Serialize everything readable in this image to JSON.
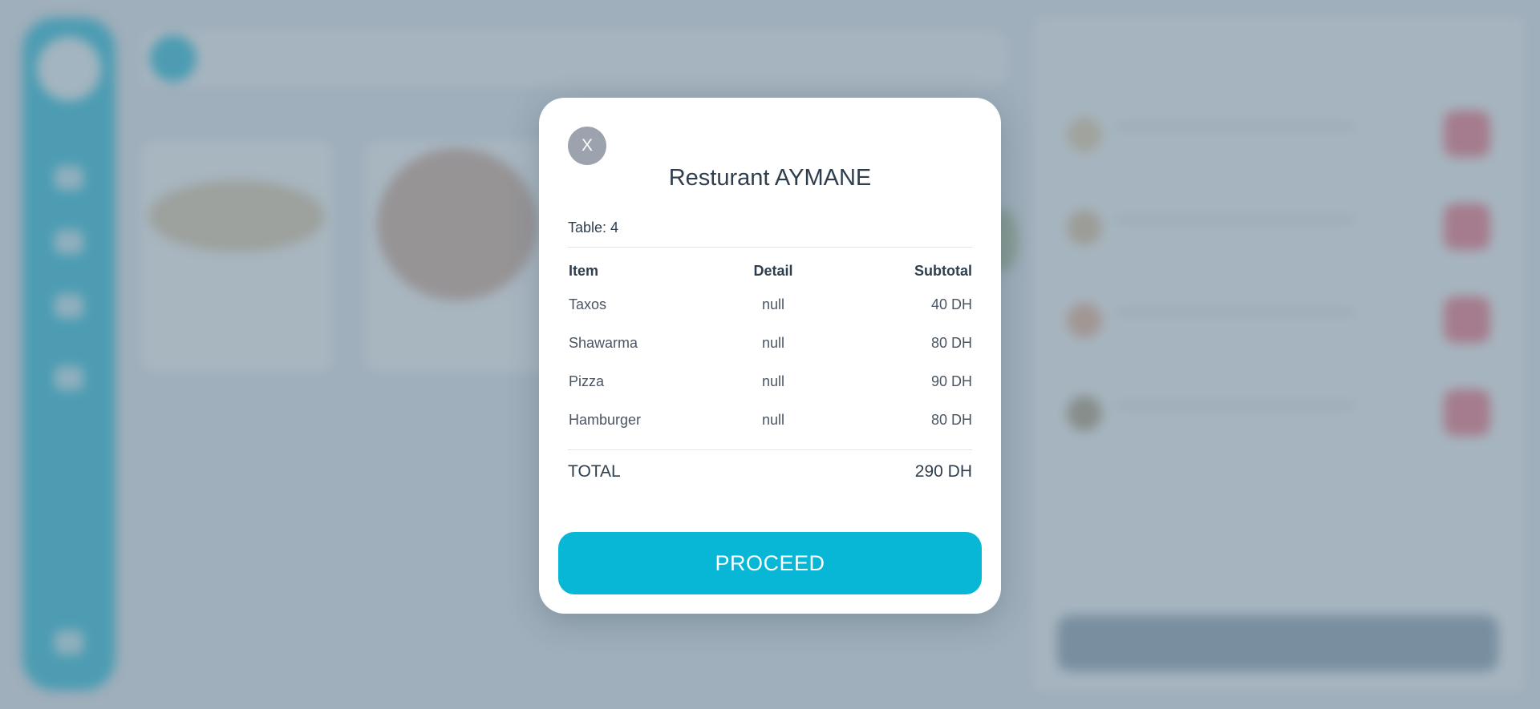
{
  "modal": {
    "close_label": "X",
    "title": "Resturant AYMANE",
    "table_label": "Table: 4",
    "columns": {
      "item": "Item",
      "detail": "Detail",
      "subtotal": "Subtotal"
    },
    "items": [
      {
        "item": "Taxos",
        "detail": "null",
        "subtotal": "40 DH"
      },
      {
        "item": "Shawarma",
        "detail": "null",
        "subtotal": "80 DH"
      },
      {
        "item": "Pizza",
        "detail": "null",
        "subtotal": "90 DH"
      },
      {
        "item": "Hamburger",
        "detail": "null",
        "subtotal": "80 DH"
      }
    ],
    "total_label": "TOTAL",
    "total_value": "290 DH",
    "proceed_label": "PROCEED"
  },
  "colors": {
    "accent": "#08b6d6",
    "danger": "#f06273",
    "overlay": "#788c9c",
    "close_button": "#9ca3ae"
  }
}
